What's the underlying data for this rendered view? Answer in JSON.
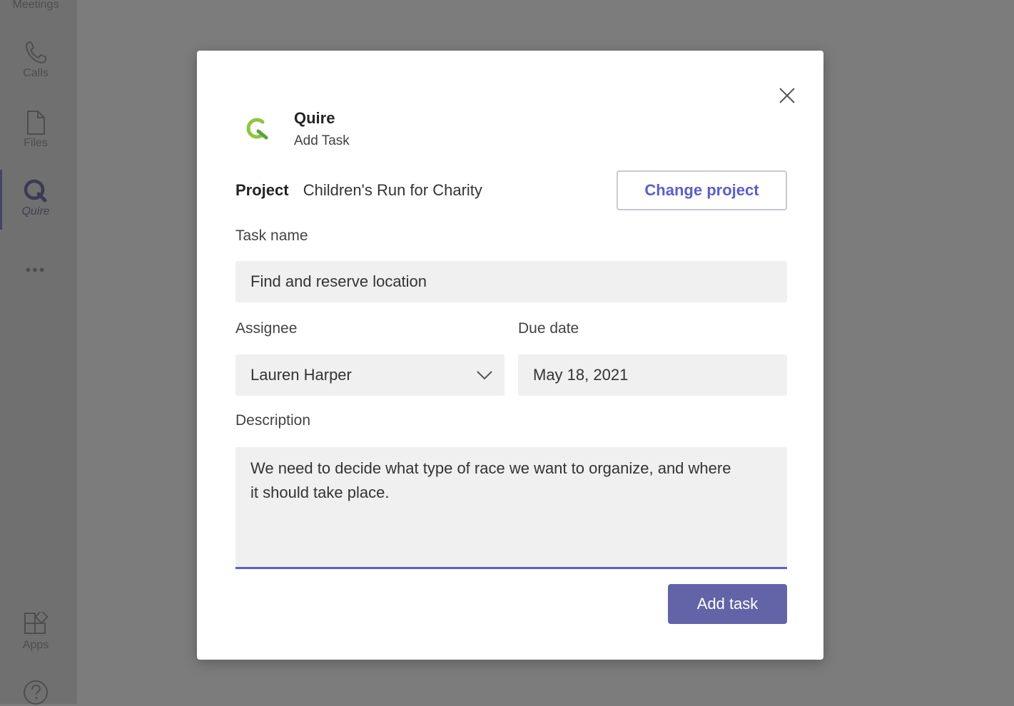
{
  "rail": {
    "items": [
      {
        "label": "Meetings",
        "icon": "calendar-icon"
      },
      {
        "label": "Calls",
        "icon": "phone-icon"
      },
      {
        "label": "Files",
        "icon": "file-icon"
      },
      {
        "label": "Quire",
        "icon": "quire-icon",
        "active": true
      },
      {
        "label": "Apps",
        "icon": "apps-icon"
      }
    ],
    "more": "•••"
  },
  "dialog": {
    "app_name": "Quire",
    "subtitle": "Add Task",
    "project_label": "Project",
    "project_value": "Children's Run for Charity",
    "change_project": "Change project",
    "task_name_label": "Task name",
    "task_name_value": "Find and reserve location",
    "assignee_label": "Assignee",
    "assignee_value": "Lauren Harper",
    "due_label": "Due date",
    "due_value": "May 18, 2021",
    "description_label": "Description",
    "description_value": "We need to decide what type of race we want to organize, and where it should take place.",
    "add_task": "Add task"
  },
  "colors": {
    "accent": "#6264a7",
    "link": "#5b5fc7",
    "logo_green": "#8dc63f",
    "overlay": "#7c7c7c"
  }
}
